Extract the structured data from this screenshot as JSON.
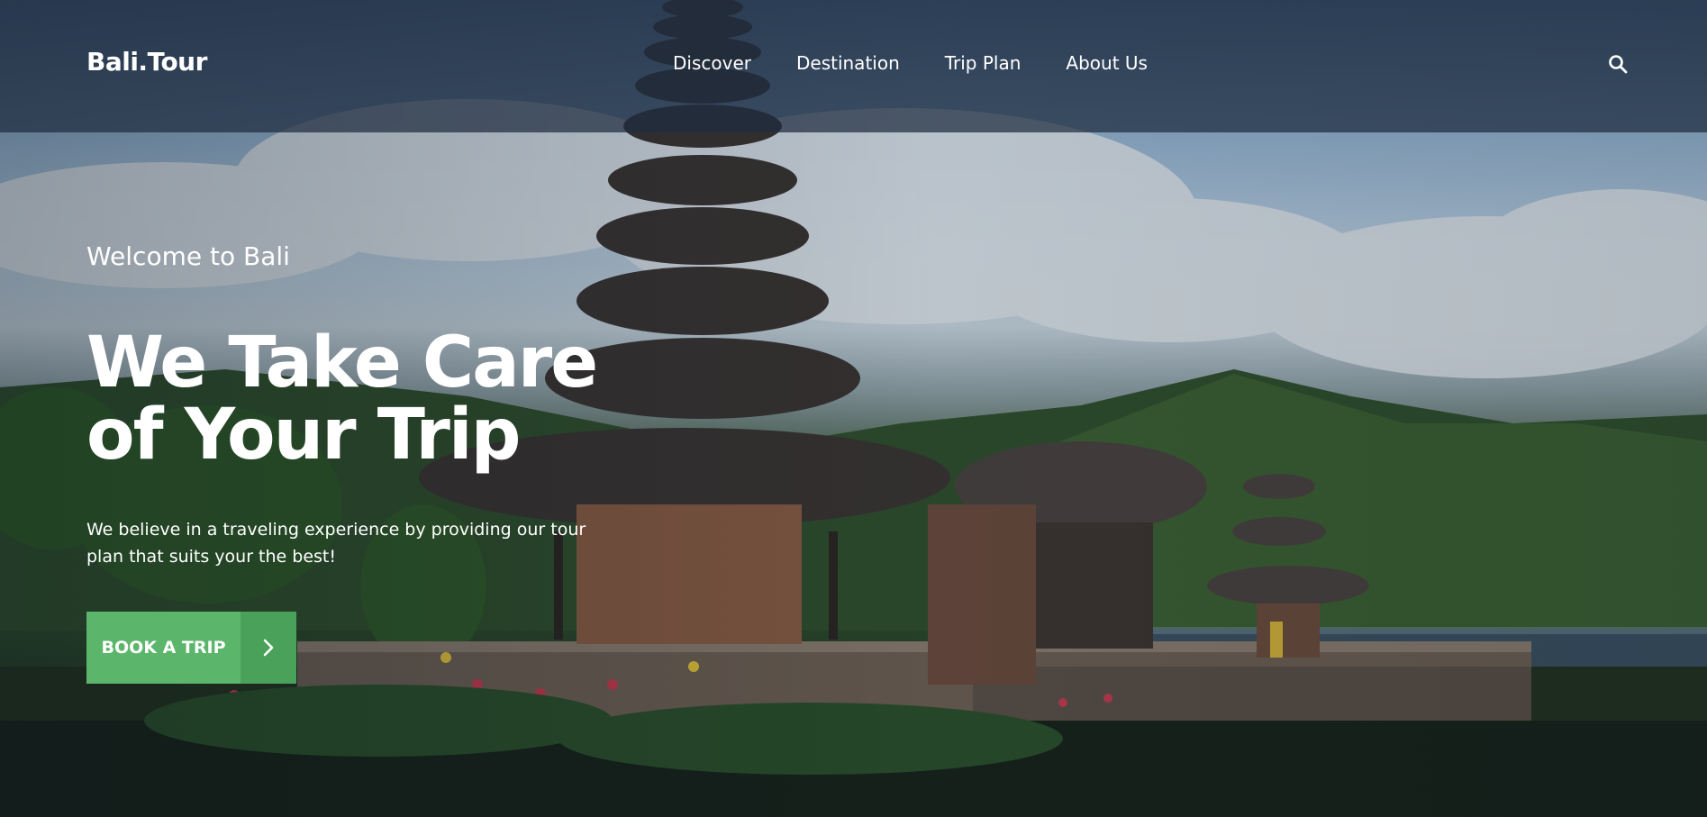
{
  "header": {
    "logo_text": "Bali.Tour",
    "nav": [
      {
        "label": "Discover"
      },
      {
        "label": "Destination"
      },
      {
        "label": "Trip Plan"
      },
      {
        "label": "About Us"
      }
    ],
    "search_icon": "search-icon"
  },
  "hero": {
    "welcome": "Welcome to Bali",
    "headline": "We Take Care of Your Trip",
    "tagline": "We believe in a traveling experience by providing our tour plan that suits your the best!",
    "cta_label": "BOOK A TRIP",
    "cta_icon": "chevron-right-icon"
  },
  "colors": {
    "accent": "#5bb56a",
    "accent_dark": "#4aa25a",
    "navbar_bg": "#1e2d40",
    "text": "#ffffff"
  }
}
